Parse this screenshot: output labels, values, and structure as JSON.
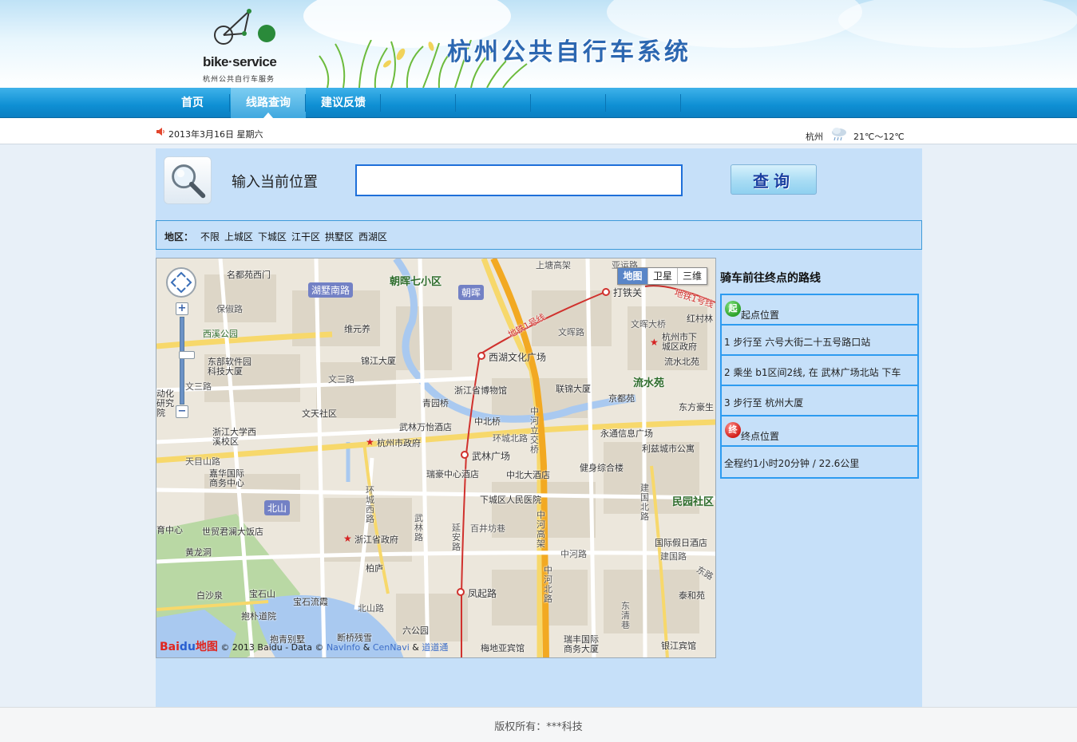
{
  "header": {
    "logo_text": "bike·service",
    "logo_subtitle": "杭州公共自行车服务",
    "site_title": "杭州公共自行车系统"
  },
  "nav": {
    "items": [
      {
        "label": "首页",
        "active": false
      },
      {
        "label": "线路查询",
        "active": true
      },
      {
        "label": "建议反馈",
        "active": false
      }
    ]
  },
  "infobar": {
    "date": "2013年3月16日  星期六",
    "weather_city": "杭州",
    "weather_temp": "21℃～12℃",
    "weather_icon": "cloud-rain-icon"
  },
  "search": {
    "label": "输入当前位置",
    "value": "",
    "placeholder": "",
    "button_label": "查询"
  },
  "district": {
    "label": "地区：",
    "items": [
      "不限",
      "上城区",
      "下城区",
      "江干区",
      "拱墅区",
      "西湖区"
    ]
  },
  "map": {
    "type_buttons": [
      "地图",
      "卫星",
      "三维"
    ],
    "selected_type": "地图",
    "zoom_in": "+",
    "zoom_out": "−",
    "copyright": "© 2013 Baidu - Data ©",
    "brand_a": "Bai",
    "brand_b": "du",
    "brand_c": "地图",
    "data_sources": [
      "NavInfo",
      "CenNavi",
      "道道通"
    ],
    "source_sep": "&",
    "labels": {
      "l1": "名都苑西门",
      "l2": "朝晖七小区",
      "l3": "保俶路",
      "l4": "西溪公园",
      "l5": "维元养",
      "l6": "锦江大厦",
      "l7": "东部软件园科技大厦",
      "l8": "文三路",
      "l9": "浙江省博物馆",
      "l10": "青园桥",
      "l11": "文天社区",
      "l12": "浙江大学西溪校区",
      "l13": "杭州市政府",
      "l14": "武林万怡酒店",
      "l15": "中北桥",
      "l16": "环城北路",
      "l17": "天目山路",
      "l18": "嘉华国际商务中心",
      "l19": "瑞豪中心酒店",
      "l20": "中北大酒店",
      "l21": "下城区人民医院",
      "l22": "世贸君澜大饭店",
      "l23": "百井坊巷",
      "l24": "浙江省政府",
      "l25": "黄龙洞",
      "l26": "柏庐",
      "l27": "白沙泉",
      "l28": "宝石山",
      "l29": "宝石流霞",
      "l30": "抱朴道院",
      "l31": "北山路",
      "l32": "抱青别墅",
      "l33": "断桥残雪",
      "l34": "六公园",
      "l35": "梅地亚宾馆",
      "l36": "瑞丰国际商务大厦",
      "l37": "银江宾馆",
      "l38": "东清巷",
      "l39": "泰和苑",
      "l40": "国际假日酒店",
      "l41": "建国北路",
      "l42": "民园社区",
      "l43": "利兹城市公寓",
      "l44": "永通信息广场",
      "l45": "健身综合楼",
      "l46": "流水苑",
      "l47": "东方豪生",
      "l48": "京都苑",
      "l49": "联锦大厦",
      "l50": "文晖路",
      "l51": "文晖大桥",
      "l52": "红村林",
      "l53": "杭州市下城区政府",
      "l54": "流水北苑",
      "l55": "中河路",
      "l56": "建国路",
      "l57": "中河高架",
      "l58": "中河北路",
      "l59": "延安路",
      "l60": "武林路",
      "l61": "环城西路",
      "l62": "动化研究院",
      "l63": "文三路",
      "l64": "浙江大学西溪校区",
      "l65": "育中心",
      "l66": "上塘高架",
      "l67": "中河立交桥",
      "l68": "地铁1号线",
      "l69": "地铁1号线",
      "l70": "亚运路",
      "l71": "东路"
    },
    "badges": {
      "b1": "湖墅南路",
      "b2": "朝晖",
      "b3": "北山"
    },
    "stations": {
      "s1": "打铁关",
      "s2": "西湖文化广场",
      "s3": "武林广场",
      "s4": "凤起路"
    }
  },
  "route": {
    "title": "骑车前往终点的路线",
    "start_marker": "起",
    "start_label": "起点位置",
    "steps": [
      "1  步行至  六号大街二十五号路口站",
      "2  乘坐  b1区间2线, 在  武林广场北站  下车",
      "3  步行至  杭州大厦"
    ],
    "end_marker": "终",
    "end_label": "终点位置",
    "summary": "全程约1小时20分钟  /  22.6公里"
  },
  "footer": {
    "text": "版权所有：***科技"
  }
}
